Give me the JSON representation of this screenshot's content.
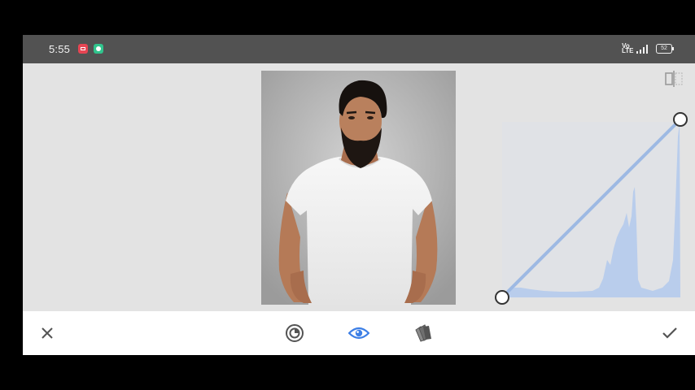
{
  "status_bar": {
    "time": "5:55",
    "network_label": "Vo LTE",
    "battery_level": "52"
  },
  "icons": {
    "recorder": "screen-recorder-icon",
    "chat": "chat-notification-icon",
    "compare": "compare-icon",
    "cancel": "close-icon",
    "preset": "curves-preset-icon",
    "view": "eye-icon",
    "channel": "color-channel-icon",
    "apply": "checkmark-icon"
  },
  "editor": {
    "tool": "curves",
    "active_toolbar_item": "view",
    "curve_points": [
      {
        "input": 0,
        "output": 0
      },
      {
        "input": 255,
        "output": 255
      }
    ]
  },
  "colors": {
    "accent": "#3d7fe6",
    "curve_line": "#9db9e3",
    "histogram_fill": "#b9cdec",
    "toolbar_icon": "#545454"
  }
}
